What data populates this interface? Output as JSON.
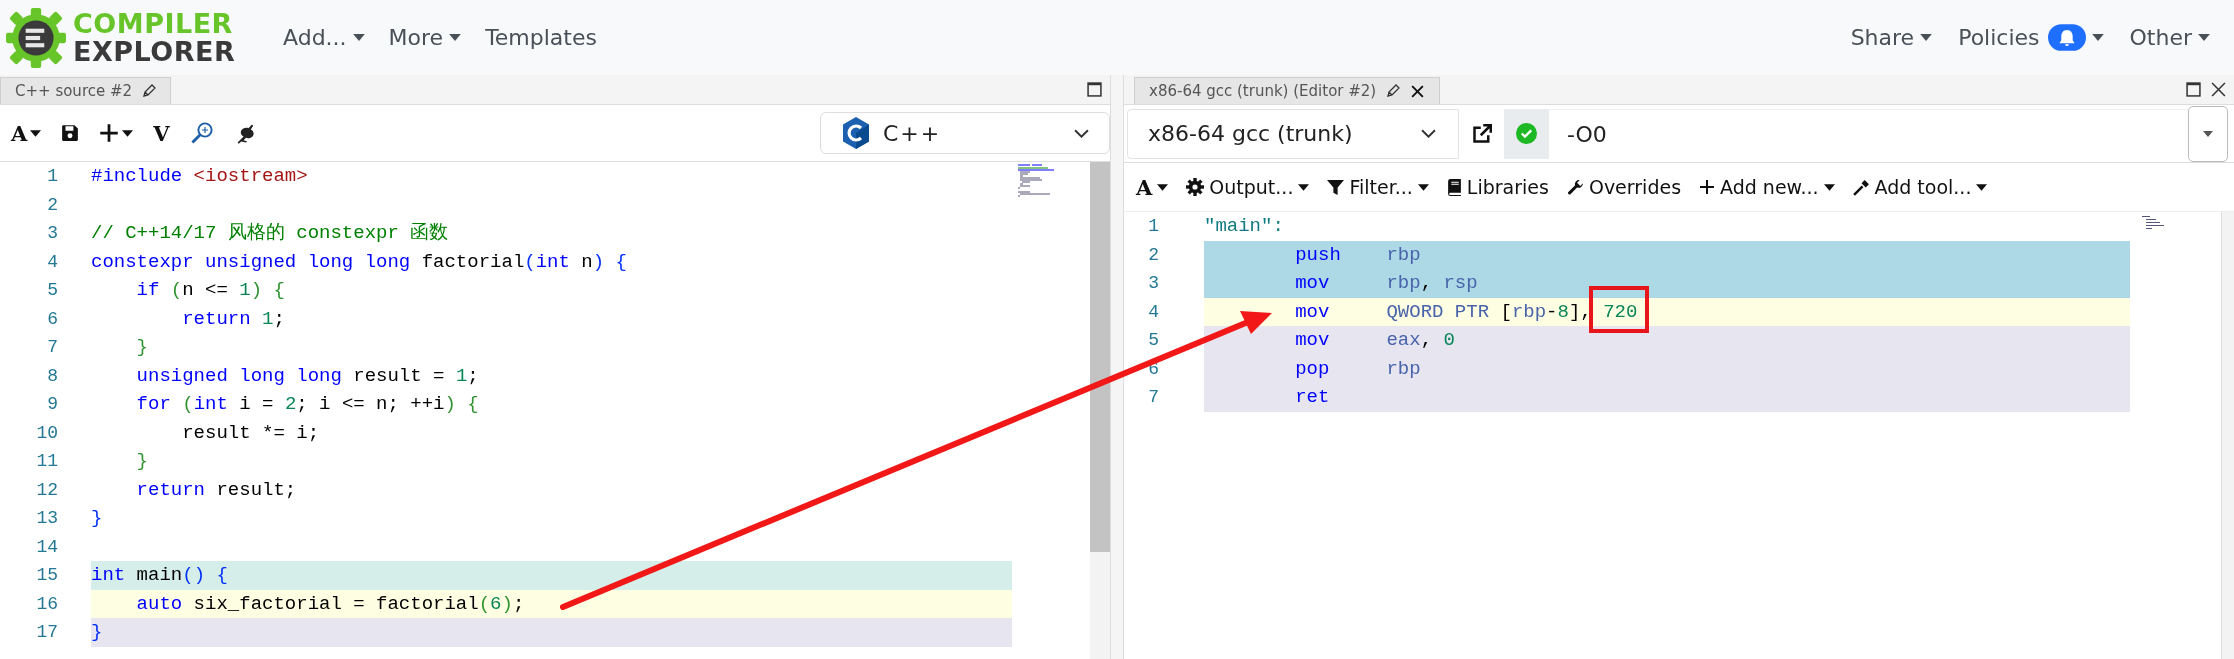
{
  "header": {
    "logo": {
      "line1": "COMPILER",
      "line2": "EXPLORER"
    },
    "menus": [
      {
        "label": "Add...",
        "kind": "dropdown"
      },
      {
        "label": "More",
        "kind": "dropdown"
      },
      {
        "label": "Templates",
        "kind": "link"
      }
    ],
    "right_menus": [
      {
        "label": "Share",
        "kind": "dropdown"
      },
      {
        "label": "Policies",
        "kind": "notify"
      },
      {
        "label": "Other",
        "kind": "dropdown"
      }
    ]
  },
  "source_pane": {
    "tab": {
      "title": "C++ source #2"
    },
    "toolbar": [
      {
        "kind": "letter",
        "label": "A",
        "dropdown": true
      },
      {
        "kind": "save",
        "dropdown": false
      },
      {
        "kind": "plus",
        "dropdown": true
      },
      {
        "kind": "letter",
        "label": "V",
        "dropdown": false
      },
      {
        "kind": "insights",
        "dropdown": false
      },
      {
        "kind": "bench",
        "dropdown": false
      }
    ],
    "language": "C++",
    "lines": [
      {
        "number": "1",
        "tokens": [
          {
            "kind": "kw",
            "text": "#include"
          },
          {
            "kind": "str",
            "text": " <iostream>"
          }
        ]
      },
      {
        "number": "2"
      },
      {
        "number": "3",
        "tokens": [
          {
            "kind": "comment",
            "text": "// C++14/17 风格的 constexpr 函数"
          }
        ]
      },
      {
        "number": "4",
        "tokens": [
          {
            "kind": "kw",
            "text": "constexpr unsigned long long"
          },
          {
            "kind": "text",
            "text": " factorial"
          },
          {
            "kind": "b1",
            "text": "("
          },
          {
            "kind": "kw",
            "text": "int"
          },
          {
            "kind": "text",
            "text": " n"
          },
          {
            "kind": "b1",
            "text": ")"
          },
          {
            "kind": "b1",
            "text": " {"
          }
        ]
      },
      {
        "number": "5",
        "tokens": [
          {
            "kind": "kw",
            "text": "    if"
          },
          {
            "kind": "b2",
            "text": " ("
          },
          {
            "kind": "text",
            "text": "n <= "
          },
          {
            "kind": "num",
            "text": "1"
          },
          {
            "kind": "b2",
            "text": ")"
          },
          {
            "kind": "b2",
            "text": " {"
          }
        ]
      },
      {
        "number": "6",
        "tokens": [
          {
            "kind": "kw",
            "text": "        return"
          },
          {
            "kind": "num",
            "text": " 1"
          },
          {
            "kind": "text",
            "text": ";"
          }
        ]
      },
      {
        "number": "7",
        "tokens": [
          {
            "kind": "b2",
            "text": "    }"
          }
        ]
      },
      {
        "number": "8",
        "tokens": [
          {
            "kind": "kw",
            "text": "    unsigned long long"
          },
          {
            "kind": "text",
            "text": " result = "
          },
          {
            "kind": "num",
            "text": "1"
          },
          {
            "kind": "text",
            "text": ";"
          }
        ]
      },
      {
        "number": "9",
        "tokens": [
          {
            "kind": "kw",
            "text": "    for"
          },
          {
            "kind": "b2",
            "text": " ("
          },
          {
            "kind": "kw",
            "text": "int"
          },
          {
            "kind": "text",
            "text": " i = "
          },
          {
            "kind": "num",
            "text": "2"
          },
          {
            "kind": "text",
            "text": "; i <= n; ++i"
          },
          {
            "kind": "b2",
            "text": ")"
          },
          {
            "kind": "b2",
            "text": " {"
          }
        ]
      },
      {
        "number": "10",
        "tokens": [
          {
            "kind": "text",
            "text": "        result *= i;"
          }
        ]
      },
      {
        "number": "11",
        "tokens": [
          {
            "kind": "b2",
            "text": "    }"
          }
        ]
      },
      {
        "number": "12",
        "tokens": [
          {
            "kind": "kw",
            "text": "    return"
          },
          {
            "kind": "text",
            "text": " result;"
          }
        ]
      },
      {
        "number": "13",
        "tokens": [
          {
            "kind": "b1",
            "text": "}"
          }
        ]
      },
      {
        "number": "14"
      },
      {
        "number": "15",
        "color": "#d5eee9",
        "tokens": [
          {
            "kind": "kw",
            "text": "int"
          },
          {
            "kind": "text",
            "text": " main"
          },
          {
            "kind": "b1",
            "text": "()"
          },
          {
            "kind": "b1",
            "text": " {"
          }
        ]
      },
      {
        "number": "16",
        "color": "#fefee3",
        "tokens": [
          {
            "kind": "kw",
            "text": "    auto"
          },
          {
            "kind": "text",
            "text": " six_factorial = factorial"
          },
          {
            "kind": "b2",
            "text": "("
          },
          {
            "kind": "num",
            "text": "6"
          },
          {
            "kind": "b2",
            "text": ")"
          },
          {
            "kind": "text",
            "text": ";"
          }
        ]
      },
      {
        "number": "17",
        "color": "#e6e5f0",
        "tokens": [
          {
            "kind": "b1",
            "text": "}"
          }
        ]
      }
    ]
  },
  "compiler_pane": {
    "tab": {
      "title": "x86-64 gcc (trunk) (Editor #2)"
    },
    "compiler": "x86-64 gcc (trunk)",
    "options": "-O0",
    "toolbar": [
      {
        "kind": "letter",
        "label": "A",
        "dropdown": true
      },
      {
        "kind": "gear",
        "label": "Output...",
        "dropdown": true
      },
      {
        "kind": "funnel",
        "label": "Filter...",
        "dropdown": true
      },
      {
        "kind": "book",
        "label": "Libraries",
        "dropdown": false
      },
      {
        "kind": "wrench",
        "label": "Overrides",
        "dropdown": false
      },
      {
        "kind": "plus",
        "label": "Add new...",
        "dropdown": true
      },
      {
        "kind": "wand",
        "label": "Add tool...",
        "dropdown": true
      }
    ],
    "lines": [
      {
        "number": "1",
        "tokens": [
          {
            "kind": "label",
            "text": "\"main\":"
          }
        ]
      },
      {
        "number": "2",
        "color": "#add8e6",
        "tokens": [
          {
            "kind": "op",
            "text": "        push"
          },
          {
            "kind": "reg",
            "text": "    rbp"
          }
        ]
      },
      {
        "number": "3",
        "color": "#add8e6",
        "tokens": [
          {
            "kind": "op",
            "text": "        mov"
          },
          {
            "kind": "reg",
            "text": "     rbp"
          },
          {
            "kind": "text",
            "text": ", "
          },
          {
            "kind": "reg",
            "text": "rsp"
          }
        ]
      },
      {
        "number": "4",
        "color": "#fefee3",
        "tokens": [
          {
            "kind": "op",
            "text": "        mov"
          },
          {
            "kind": "reg",
            "text": "     QWORD PTR"
          },
          {
            "kind": "text",
            "text": " ["
          },
          {
            "kind": "reg",
            "text": "rbp"
          },
          {
            "kind": "text",
            "text": "-"
          },
          {
            "kind": "num",
            "text": "8"
          },
          {
            "kind": "text",
            "text": "], "
          },
          {
            "kind": "num",
            "text": "720"
          }
        ]
      },
      {
        "number": "5",
        "color": "#e6e5f0",
        "tokens": [
          {
            "kind": "op",
            "text": "        mov"
          },
          {
            "kind": "reg",
            "text": "     eax"
          },
          {
            "kind": "text",
            "text": ", "
          },
          {
            "kind": "num",
            "text": "0"
          }
        ]
      },
      {
        "number": "6",
        "color": "#e6e5f0",
        "tokens": [
          {
            "kind": "op",
            "text": "        pop"
          },
          {
            "kind": "reg",
            "text": "     rbp"
          }
        ]
      },
      {
        "number": "7",
        "color": "#e6e5f0",
        "tokens": [
          {
            "kind": "op",
            "text": "        ret"
          }
        ]
      }
    ]
  }
}
